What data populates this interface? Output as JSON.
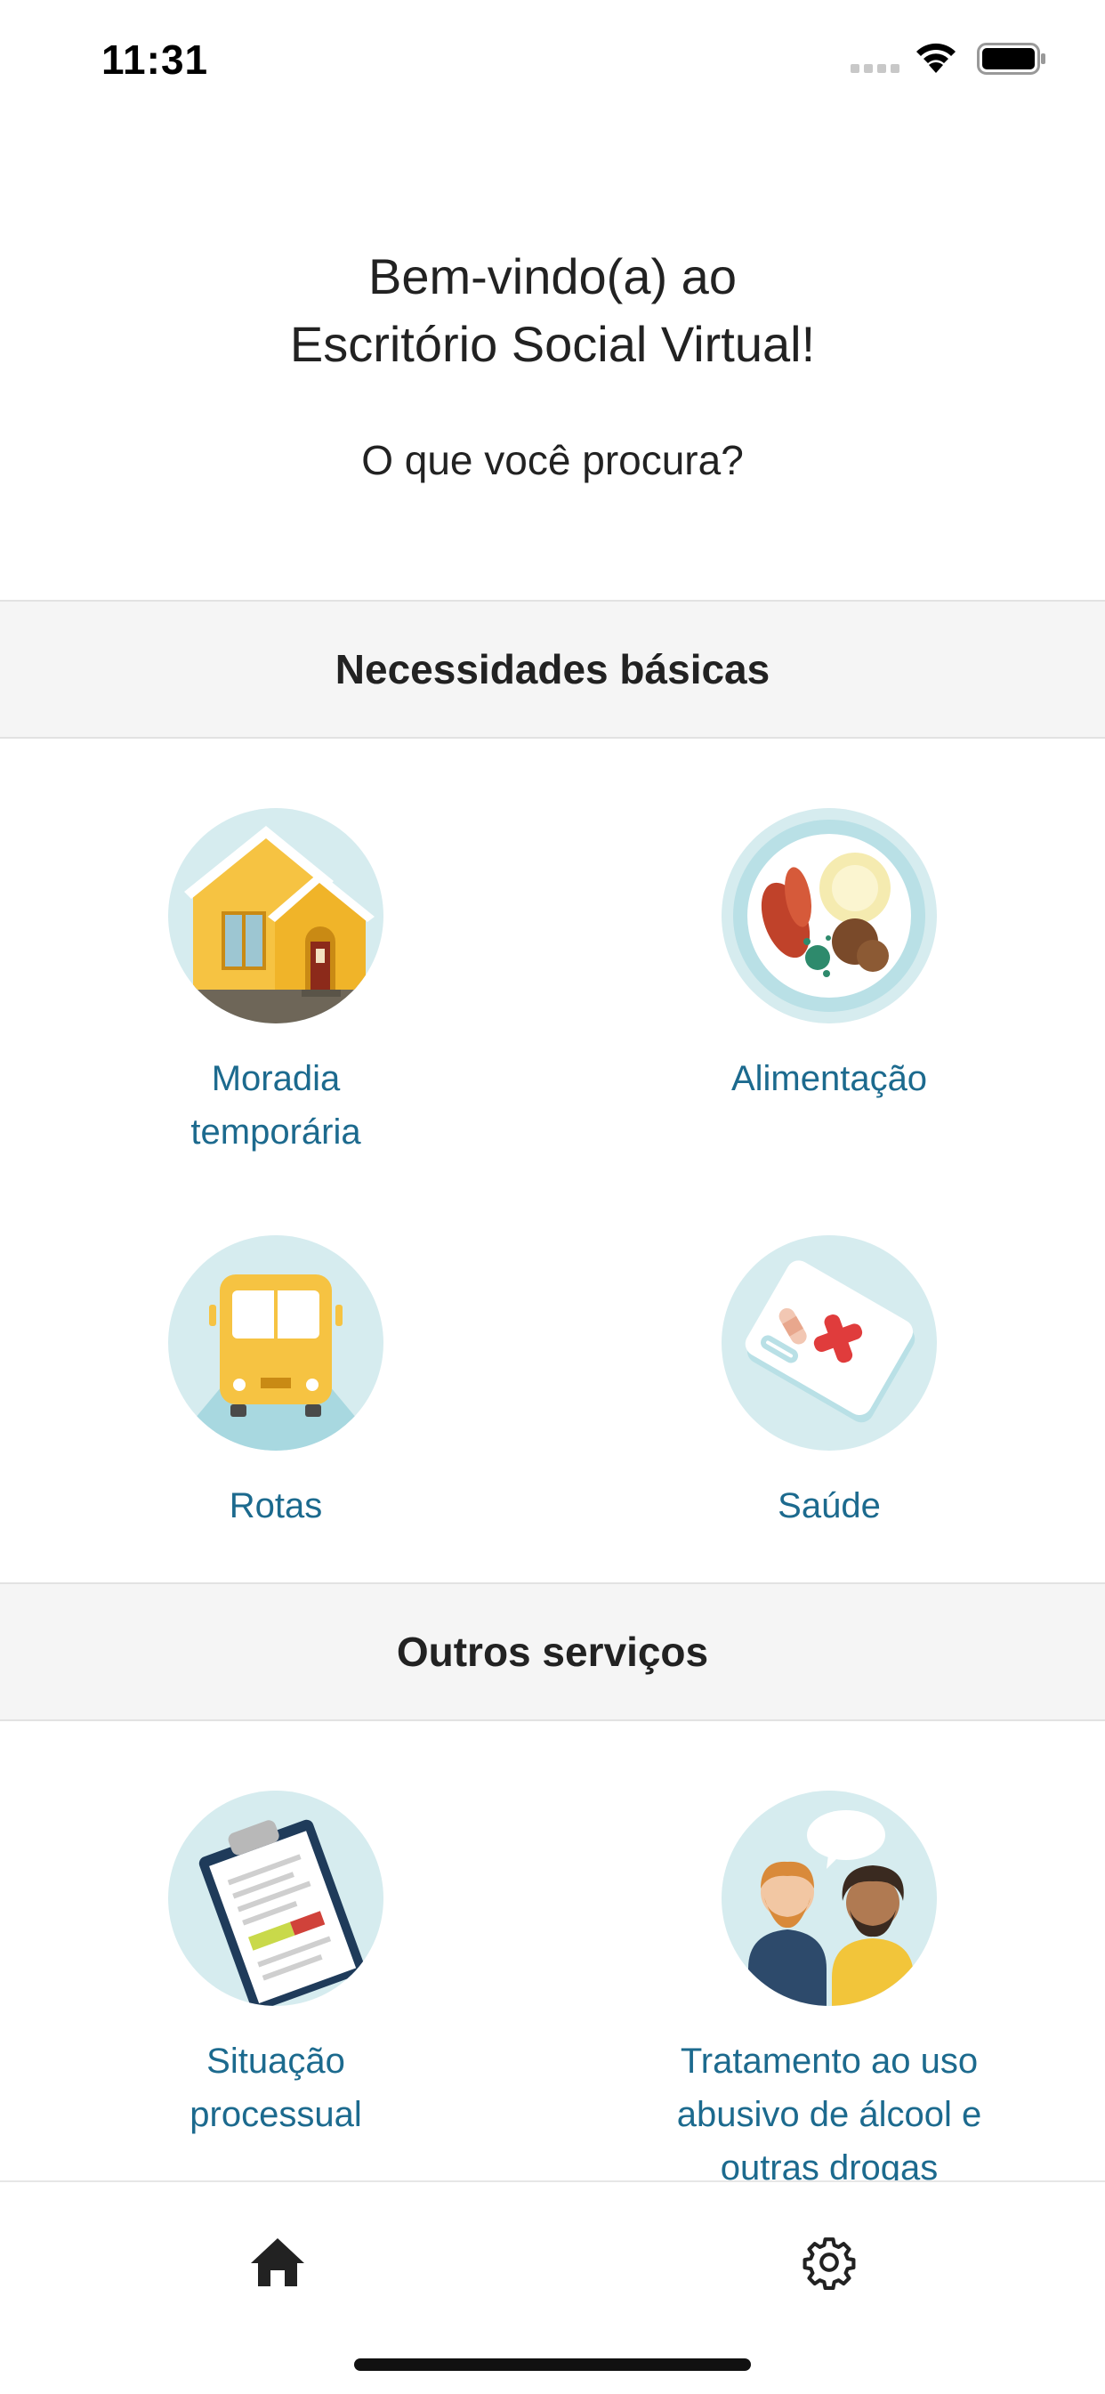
{
  "status_bar": {
    "time": "11:31"
  },
  "welcome": {
    "line1": "Bem-vindo(a) ao",
    "line2": "Escritório Social Virtual!",
    "prompt": "O que você procura?"
  },
  "sections": [
    {
      "title": "Necessidades básicas",
      "items": [
        {
          "icon": "house-icon",
          "label_lines": [
            "Moradia",
            "temporária"
          ]
        },
        {
          "icon": "food-plate-icon",
          "label_lines": [
            "Alimentação"
          ]
        },
        {
          "icon": "bus-icon",
          "label_lines": [
            "Rotas"
          ]
        },
        {
          "icon": "first-aid-kit-icon",
          "label_lines": [
            "Saúde"
          ]
        }
      ]
    },
    {
      "title": "Outros serviços",
      "items": [
        {
          "icon": "clipboard-icon",
          "label_lines": [
            "Situação",
            "processual"
          ]
        },
        {
          "icon": "people-conversation-icon",
          "label_lines": [
            "Tratamento ao uso",
            "abusivo de álcool e",
            "outras drogas"
          ]
        }
      ]
    }
  ],
  "tab_bar": {
    "tabs": [
      {
        "icon": "home-icon"
      },
      {
        "icon": "gear-icon"
      }
    ]
  },
  "colors": {
    "accent_text": "#1c6a8e",
    "icon_circle": "#d6ecef",
    "section_background": "#f5f5f5"
  }
}
